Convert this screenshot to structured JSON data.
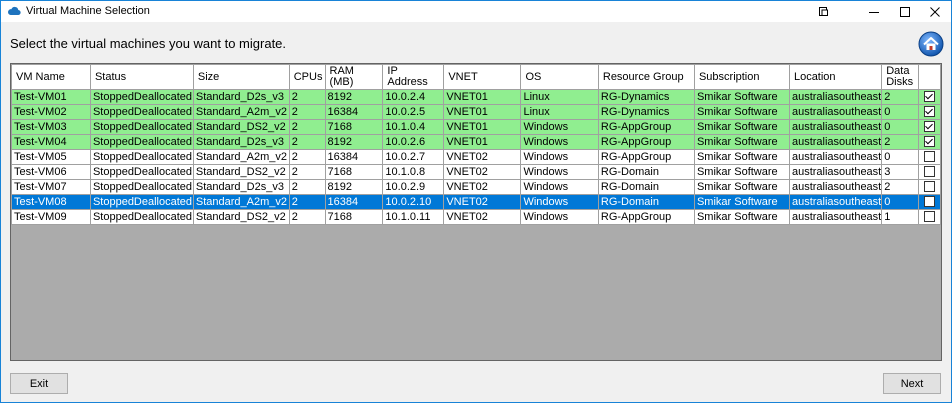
{
  "window": {
    "title": "Virtual Machine Selection"
  },
  "heading": "Select the virtual machines you want to migrate.",
  "table": {
    "columns": [
      {
        "label": "VM Name"
      },
      {
        "label": "Status"
      },
      {
        "label": "Size"
      },
      {
        "label": "CPUs"
      },
      {
        "label": "RAM\n(MB)"
      },
      {
        "label": "IP\nAddress"
      },
      {
        "label": "VNET"
      },
      {
        "label": "OS"
      },
      {
        "label": "Resource Group"
      },
      {
        "label": "Subscription"
      },
      {
        "label": "Location"
      },
      {
        "label": "Data\nDisks"
      },
      {
        "label": ""
      }
    ],
    "rows": [
      {
        "cells": [
          "Test-VM01",
          "StoppedDeallocated",
          "Standard_D2s_v3",
          "2",
          "8192",
          "10.0.2.4",
          "VNET01",
          "Linux",
          "RG-Dynamics",
          "Smikar Software",
          "australiasoutheast",
          "2"
        ],
        "checked": true,
        "state": "migrate"
      },
      {
        "cells": [
          "Test-VM02",
          "StoppedDeallocated",
          "Standard_A2m_v2",
          "2",
          "16384",
          "10.0.2.5",
          "VNET01",
          "Linux",
          "RG-Dynamics",
          "Smikar Software",
          "australiasoutheast",
          "0"
        ],
        "checked": true,
        "state": "migrate"
      },
      {
        "cells": [
          "Test-VM03",
          "StoppedDeallocated",
          "Standard_DS2_v2",
          "2",
          "7168",
          "10.1.0.4",
          "VNET01",
          "Windows",
          "RG-AppGroup",
          "Smikar Software",
          "australiasoutheast",
          "0"
        ],
        "checked": true,
        "state": "migrate"
      },
      {
        "cells": [
          "Test-VM04",
          "StoppedDeallocated",
          "Standard_D2s_v3",
          "2",
          "8192",
          "10.0.2.6",
          "VNET01",
          "Windows",
          "RG-AppGroup",
          "Smikar Software",
          "australiasoutheast",
          "2"
        ],
        "checked": true,
        "state": "migrate"
      },
      {
        "cells": [
          "Test-VM05",
          "StoppedDeallocated",
          "Standard_A2m_v2",
          "2",
          "16384",
          "10.0.2.7",
          "VNET02",
          "Windows",
          "RG-AppGroup",
          "Smikar Software",
          "australiasoutheast",
          "0"
        ],
        "checked": false,
        "state": "normal"
      },
      {
        "cells": [
          "Test-VM06",
          "StoppedDeallocated",
          "Standard_DS2_v2",
          "2",
          "7168",
          "10.1.0.8",
          "VNET02",
          "Windows",
          "RG-Domain",
          "Smikar Software",
          "australiasoutheast",
          "3"
        ],
        "checked": false,
        "state": "normal"
      },
      {
        "cells": [
          "Test-VM07",
          "StoppedDeallocated",
          "Standard_D2s_v3",
          "2",
          "8192",
          "10.0.2.9",
          "VNET02",
          "Windows",
          "RG-Domain",
          "Smikar Software",
          "australiasoutheast",
          "2"
        ],
        "checked": false,
        "state": "normal"
      },
      {
        "cells": [
          "Test-VM08",
          "StoppedDeallocated",
          "Standard_A2m_v2",
          "2",
          "16384",
          "10.0.2.10",
          "VNET02",
          "Windows",
          "RG-Domain",
          "Smikar Software",
          "australiasoutheast",
          "0"
        ],
        "checked": false,
        "state": "selected"
      },
      {
        "cells": [
          "Test-VM09",
          "StoppedDeallocated",
          "Standard_DS2_v2",
          "2",
          "7168",
          "10.1.0.11",
          "VNET02",
          "Windows",
          "RG-AppGroup",
          "Smikar Software",
          "australiasoutheast",
          "1"
        ],
        "checked": false,
        "state": "normal"
      }
    ]
  },
  "buttons": {
    "exit": "Exit",
    "next": "Next"
  },
  "colors": {
    "migrate_row": "#90ee90",
    "selected_row": "#0078d7",
    "window_border": "#1883d7",
    "cloud_icon": "#1e73be"
  }
}
